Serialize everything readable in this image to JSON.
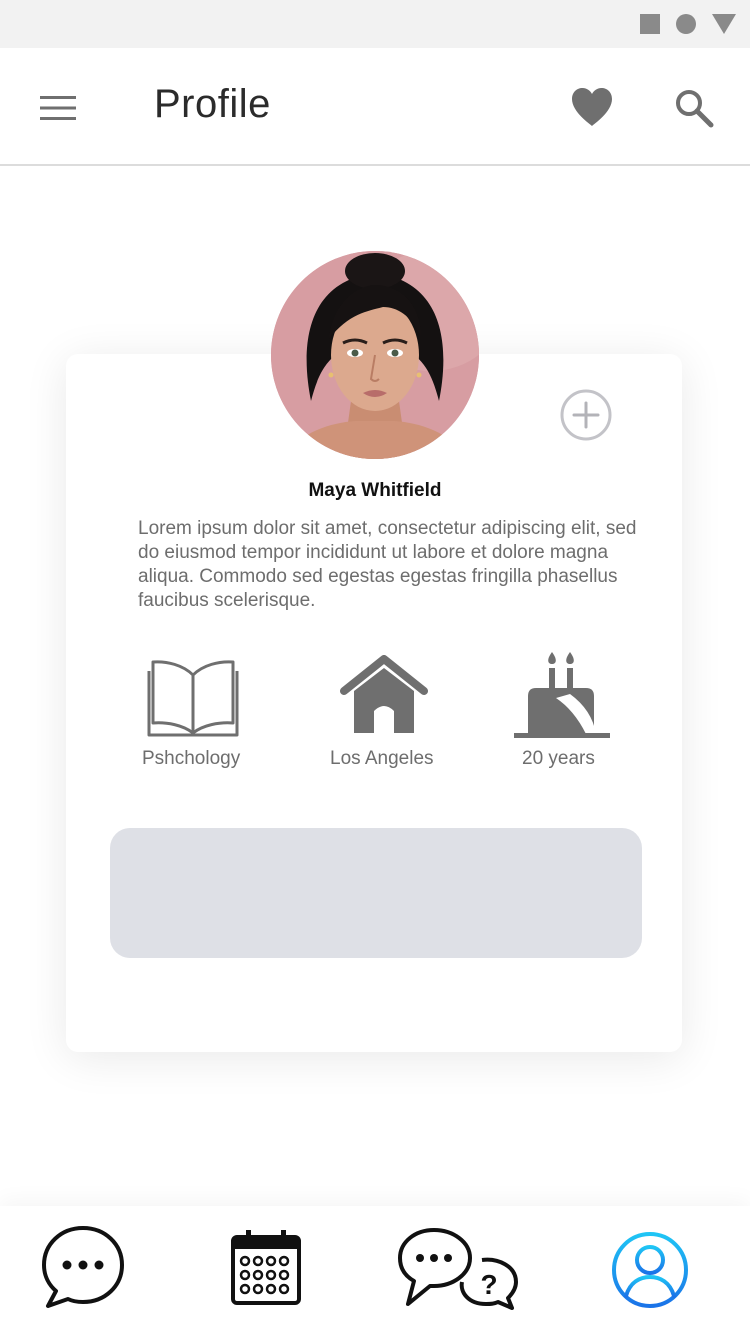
{
  "status_bar": {
    "icons": [
      "square-icon",
      "circle-icon",
      "triangle-icon"
    ]
  },
  "header": {
    "title": "Profile",
    "menu_icon": "hamburger-menu-icon",
    "favorite_icon": "heart-icon",
    "search_icon": "search-icon"
  },
  "profile": {
    "name": "Maya Whitfield",
    "bio": "Lorem ipsum dolor sit amet, consectetur adipiscing elit, sed do eiusmod tempor incididunt ut labore et dolore magna aliqua. Commodo sed egestas egestas fringilla phasellus faucibus scelerisque.",
    "add_icon": "add-circle-icon",
    "details": [
      {
        "icon": "book-icon",
        "label": "Pshchology"
      },
      {
        "icon": "home-icon",
        "label": "Los Angeles"
      },
      {
        "icon": "birthday-cake-icon",
        "label": "20 years"
      }
    ]
  },
  "bottom_nav": {
    "items": [
      {
        "icon": "chat-bubble-icon",
        "active": false
      },
      {
        "icon": "calendar-icon",
        "active": false
      },
      {
        "icon": "faq-chat-icon",
        "active": false
      },
      {
        "icon": "user-profile-icon",
        "active": true
      }
    ]
  },
  "colors": {
    "icon_gray": "#6f6f6f",
    "text_gray": "#6d6d6d",
    "action_box": "#dee0e6",
    "active_nav_start": "#1fc5f5",
    "active_nav_end": "#1a73e8",
    "avatar_bg": "#d69aa0"
  }
}
